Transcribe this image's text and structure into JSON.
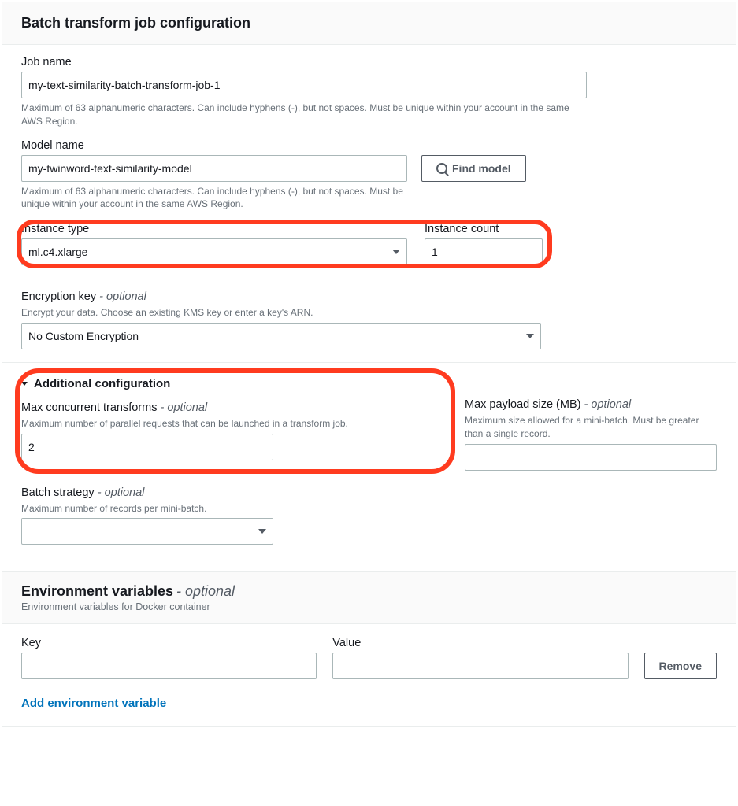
{
  "header": {
    "title": "Batch transform job configuration"
  },
  "jobName": {
    "label": "Job name",
    "value": "my-text-similarity-batch-transform-job-1",
    "helper": "Maximum of 63 alphanumeric characters. Can include hyphens (-), but not spaces. Must be unique within your account in the same AWS Region."
  },
  "modelName": {
    "label": "Model name",
    "value": "my-twinword-text-similarity-model",
    "helper": "Maximum of 63 alphanumeric characters. Can include hyphens (-), but not spaces. Must be unique within your account in the same AWS Region.",
    "findButton": "Find model"
  },
  "instanceType": {
    "label": "Instance type",
    "value": "ml.c4.xlarge"
  },
  "instanceCount": {
    "label": "Instance count",
    "value": "1"
  },
  "encryption": {
    "label": "Encryption key",
    "optional": "- optional",
    "helper": "Encrypt your data. Choose an existing KMS key or enter a key's ARN.",
    "value": "No Custom Encryption"
  },
  "additional": {
    "title": "Additional configuration",
    "maxConcurrent": {
      "label": "Max concurrent transforms",
      "optional": "- optional",
      "helper": "Maximum number of parallel requests that can be launched in a transform job.",
      "value": "2"
    },
    "maxPayload": {
      "label": "Max payload size (MB)",
      "optional": "- optional",
      "helper": "Maximum size allowed for a mini-batch. Must be greater than a single record.",
      "value": ""
    },
    "batchStrategy": {
      "label": "Batch strategy",
      "optional": "- optional",
      "helper": "Maximum number of records per mini-batch.",
      "value": ""
    }
  },
  "env": {
    "title": "Environment variables",
    "optional": "- optional",
    "sub": "Environment variables for Docker container",
    "keyLabel": "Key",
    "valueLabel": "Value",
    "remove": "Remove",
    "addLink": "Add environment variable",
    "row": {
      "key": "",
      "value": ""
    }
  }
}
